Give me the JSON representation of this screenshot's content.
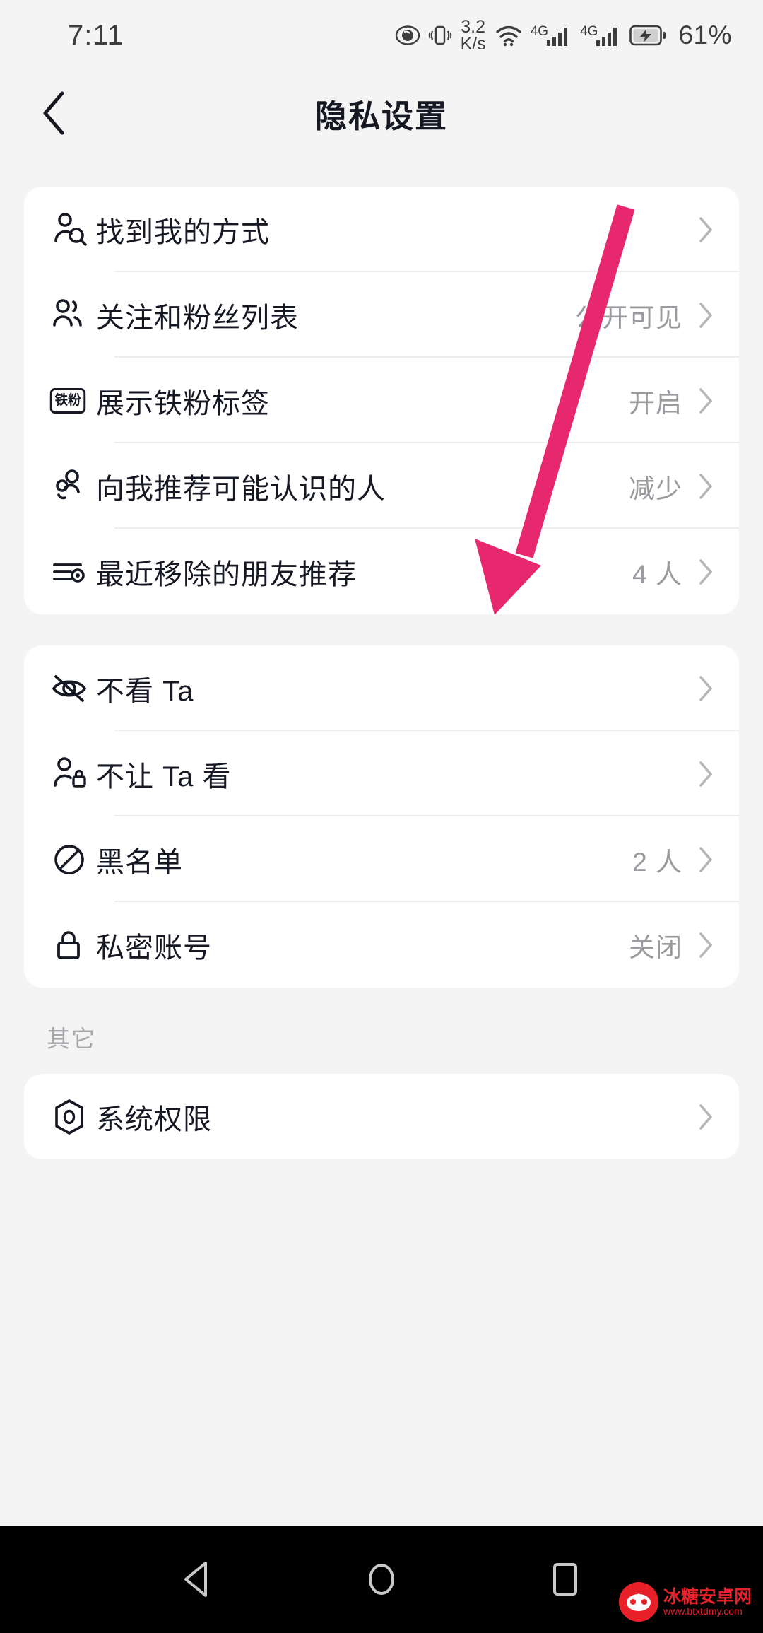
{
  "status_bar": {
    "time": "7:11",
    "net_speed_value": "3.2",
    "net_speed_unit": "K/s",
    "sim1_network": "4G",
    "sim2_network": "4G",
    "battery_percent": "61%",
    "icons": [
      "eye-care-icon",
      "vibrate-icon",
      "wifi-icon",
      "signal-icon",
      "signal-icon",
      "battery-charging-icon"
    ]
  },
  "app_bar": {
    "back_label": "返回",
    "title": "隐私设置"
  },
  "sections": [
    {
      "header": "",
      "rows": [
        {
          "icon": "person-search-icon",
          "label": "找到我的方式",
          "value": ""
        },
        {
          "icon": "people-group-icon",
          "label": "关注和粉丝列表",
          "value": "公开可见"
        },
        {
          "icon": "fan-badge-icon",
          "icon_text": "铁粉",
          "label": "展示铁粉标签",
          "value": "开启"
        },
        {
          "icon": "person-suggest-icon",
          "label": "向我推荐可能认识的人",
          "value": "减少"
        },
        {
          "icon": "filter-list-icon",
          "label": "最近移除的朋友推荐",
          "value": "4 人"
        }
      ]
    },
    {
      "header": "",
      "rows": [
        {
          "icon": "eye-off-icon",
          "label": "不看 Ta",
          "value": ""
        },
        {
          "icon": "person-lock-icon",
          "label": "不让 Ta 看",
          "value": ""
        },
        {
          "icon": "block-icon",
          "label": "黑名单",
          "value": "2 人"
        },
        {
          "icon": "lock-icon",
          "label": "私密账号",
          "value": "关闭"
        }
      ]
    },
    {
      "header": "其它",
      "rows": [
        {
          "icon": "permission-hexagon-icon",
          "label": "系统权限",
          "value": ""
        }
      ]
    }
  ],
  "nav_bar": {
    "back": "back-triangle-icon",
    "home": "home-circle-icon",
    "recents": "recents-square-icon"
  },
  "annotation": {
    "type": "arrow",
    "color": "#e8286e",
    "points_to": "向我推荐可能认识的人"
  },
  "watermark": {
    "name": "冰糖安卓网",
    "url": "www.btxtdmy.com"
  },
  "colors": {
    "page_bg": "#f4f4f4",
    "card_bg": "#ffffff",
    "text_primary": "#161823",
    "text_secondary": "#9a9a9f",
    "divider": "#ededee",
    "annotation": "#e8286e",
    "nav_bg": "#000000"
  }
}
